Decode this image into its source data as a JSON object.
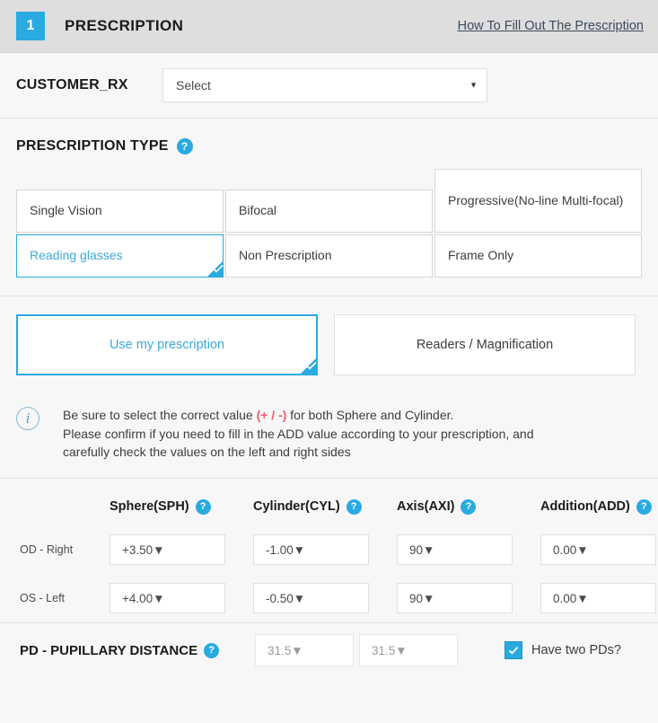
{
  "header": {
    "step_number": "1",
    "title": "PRESCRIPTION",
    "help_link": "How To Fill Out The Prescription",
    "badge_color": "#29aae1"
  },
  "customer_rx": {
    "label": "CUSTOMER_RX",
    "select_value": "Select",
    "caret": "▼"
  },
  "prescription_type": {
    "heading": "PRESCRIPTION TYPE",
    "help_icon": "?",
    "options": [
      {
        "label": "Single Vision",
        "selected": false
      },
      {
        "label": "Bifocal",
        "selected": false
      },
      {
        "label": "Progressive(No-line Multi-focal)",
        "selected": false
      },
      {
        "label": "Reading glasses",
        "selected": true
      },
      {
        "label": "Non Prescription",
        "selected": false
      },
      {
        "label": "Frame Only",
        "selected": false
      }
    ]
  },
  "mode": {
    "options": [
      {
        "label": "Use my prescription",
        "selected": true
      },
      {
        "label": "Readers / Magnification",
        "selected": false
      }
    ]
  },
  "notice": {
    "icon": "i",
    "line1_a": "Be sure to select the correct value ",
    "line1_red": "(+ / -)",
    "line1_b": " for both Sphere and Cylinder.",
    "line2": "Please confirm if you need to fill in the ADD value according to your prescription, and",
    "line3": "carefully check the values on the left and right sides",
    "red_color": "#e8616e"
  },
  "rx_table": {
    "columns": [
      {
        "label": "Sphere(SPH)",
        "help": "?"
      },
      {
        "label": "Cylinder(CYL)",
        "help": "?"
      },
      {
        "label": "Axis(AXI)",
        "help": "?"
      },
      {
        "label": "Addition(ADD)",
        "help": "?"
      }
    ],
    "rows": [
      {
        "label": "OD - Right",
        "values": [
          "+3.50",
          "-1.00",
          "90",
          "0.00"
        ]
      },
      {
        "label": "OS - Left",
        "values": [
          "+4.00",
          "-0.50",
          "90",
          "0.00"
        ]
      }
    ],
    "caret": "▼"
  },
  "pd": {
    "label": "PD - PUPILLARY DISTANCE",
    "help_icon": "?",
    "value_right": "31.5",
    "value_left": "31.5",
    "checkbox_label": "Have two PDs?",
    "checkbox_checked": true,
    "caret": "▼"
  }
}
